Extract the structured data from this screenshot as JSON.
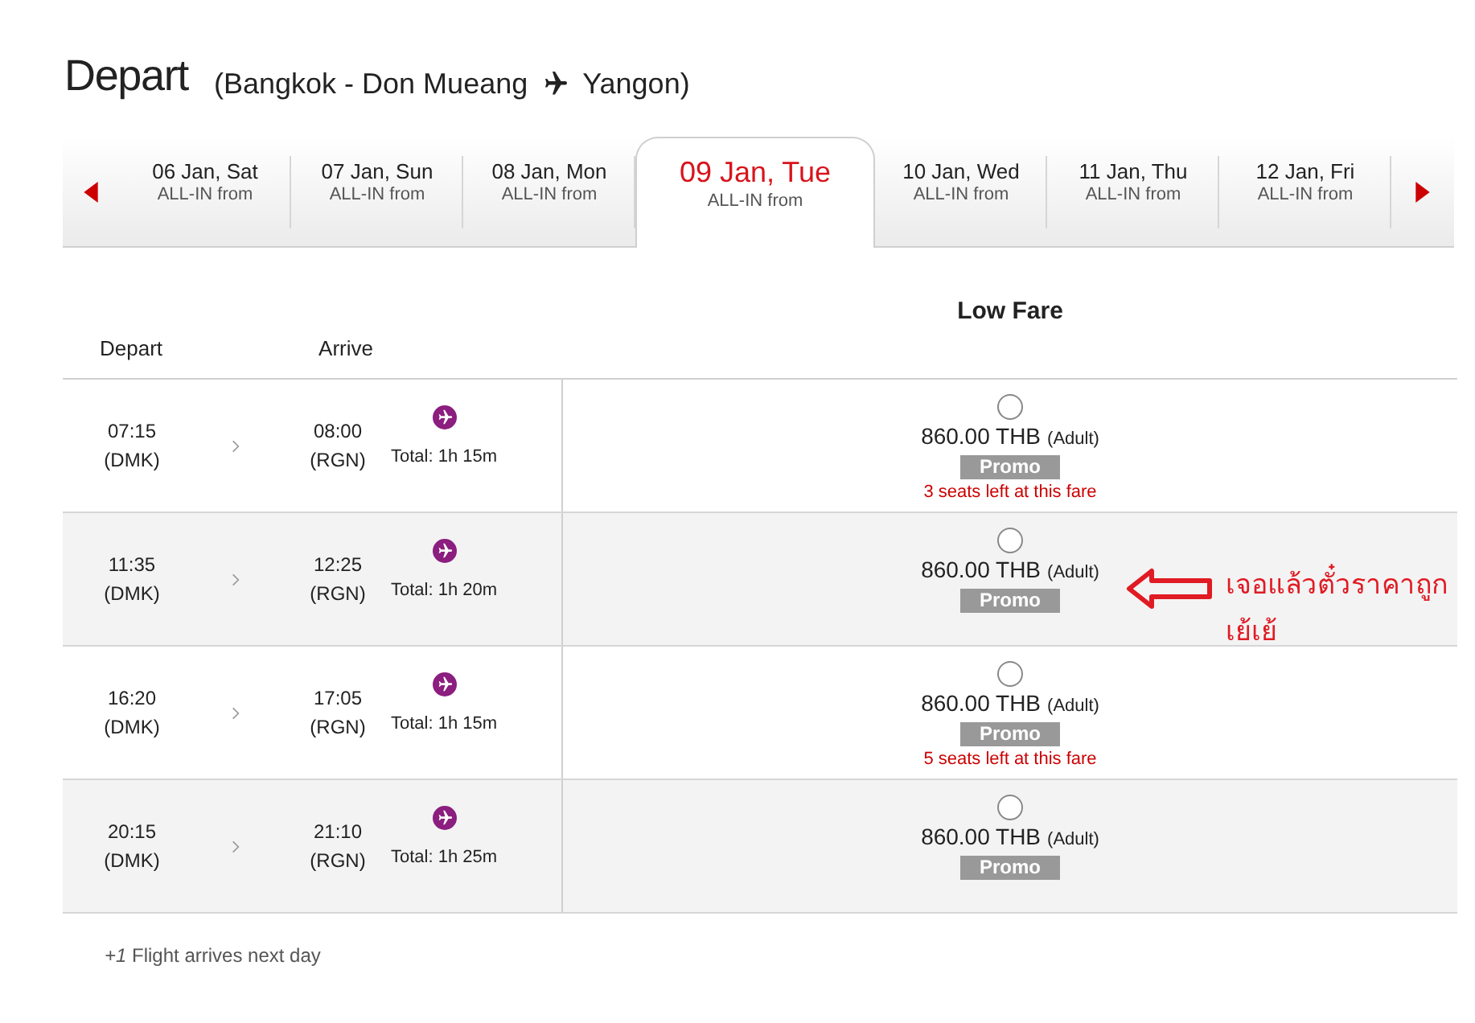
{
  "header": {
    "title": "Depart",
    "route_from": "(Bangkok - Don Mueang",
    "route_to": "Yangon)"
  },
  "date_tabs": [
    {
      "date": "06 Jan, Sat",
      "sub": "ALL-IN from",
      "selected": false
    },
    {
      "date": "07 Jan, Sun",
      "sub": "ALL-IN from",
      "selected": false
    },
    {
      "date": "08 Jan, Mon",
      "sub": "ALL-IN from",
      "selected": false
    },
    {
      "date": "09 Jan, Tue",
      "sub": "ALL-IN from",
      "selected": true
    },
    {
      "date": "10 Jan, Wed",
      "sub": "ALL-IN from",
      "selected": false
    },
    {
      "date": "11 Jan, Thu",
      "sub": "ALL-IN from",
      "selected": false
    },
    {
      "date": "12 Jan, Fri",
      "sub": "ALL-IN from",
      "selected": false
    }
  ],
  "fare_heading": "Low Fare",
  "columns": [
    "Depart",
    "Arrive"
  ],
  "flights": [
    {
      "depart_time": "07:15",
      "depart_airport": "(DMK)",
      "arrive_time": "08:00",
      "arrive_airport": "(RGN)",
      "total": "Total: 1h 15m",
      "price": "860.00 THB",
      "passenger": "(Adult)",
      "badge": "Promo",
      "seats_left": "3 seats left at this fare",
      "selected": false
    },
    {
      "depart_time": "11:35",
      "depart_airport": "(DMK)",
      "arrive_time": "12:25",
      "arrive_airport": "(RGN)",
      "total": "Total: 1h 20m",
      "price": "860.00 THB",
      "passenger": "(Adult)",
      "badge": "Promo",
      "selected": false
    },
    {
      "depart_time": "16:20",
      "depart_airport": "(DMK)",
      "arrive_time": "17:05",
      "arrive_airport": "(RGN)",
      "total": "Total: 1h 15m",
      "price": "860.00 THB",
      "passenger": "(Adult)",
      "badge": "Promo",
      "seats_left": "5 seats left at this fare",
      "selected": false
    },
    {
      "depart_time": "20:15",
      "depart_airport": "(DMK)",
      "arrive_time": "21:10",
      "arrive_airport": "(RGN)",
      "total": "Total: 1h 25m",
      "price": "860.00 THB",
      "passenger": "(Adult)",
      "badge": "Promo",
      "selected": false
    }
  ],
  "annotation": {
    "text": "เจอแล้วตั๋วราคาถูก เย้เย้"
  },
  "footnote": "*+1* Flight arrives next day"
}
